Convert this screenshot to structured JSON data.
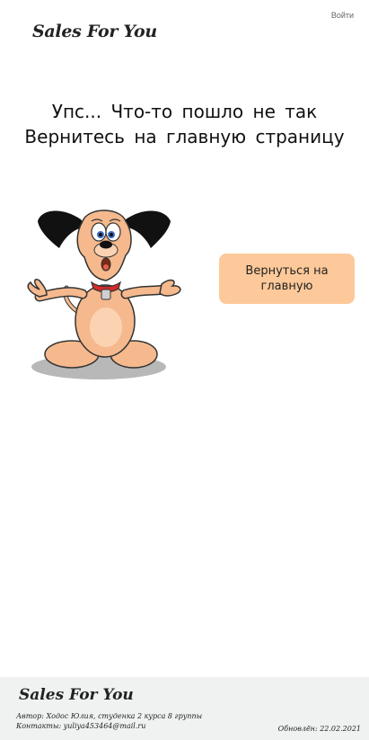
{
  "header": {
    "login_label": "Войти",
    "logo_text": "Sales For You"
  },
  "error": {
    "line1": "Упс... Что-то пошло не так",
    "line2": "Вернитесь на главную страницу"
  },
  "illustration": {
    "icon": "cartoon-dog-shrugging"
  },
  "home_button": {
    "label": "Вернуться на главную",
    "color": "#fdc99a"
  },
  "footer": {
    "logo_text": "Sales For You",
    "author": "Автор: Ходос Юлия, студенка 2 курса 8 группы",
    "contacts": "Контакты: yuliya453464@mail.ru",
    "updated": "Обновлён: 22.02.2021",
    "background": "#f0f2f2"
  }
}
